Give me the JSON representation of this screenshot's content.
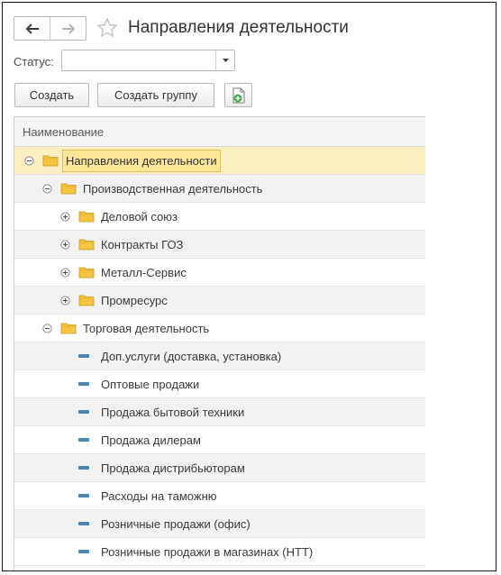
{
  "header": {
    "title": "Направления деятельности",
    "back_icon": "arrow-left-icon",
    "forward_icon": "arrow-right-icon",
    "favorite_icon": "star-icon"
  },
  "filter": {
    "status_label": "Статус:",
    "status_value": ""
  },
  "toolbar": {
    "create_label": "Создать",
    "create_group_label": "Создать группу"
  },
  "table": {
    "column_header": "Наименование",
    "rows": [
      {
        "label": "Направления деятельности",
        "level": 0,
        "kind": "group",
        "state": "expanded"
      },
      {
        "label": "Производственная деятельность",
        "level": 1,
        "kind": "group",
        "state": "expanded"
      },
      {
        "label": "Деловой союз",
        "level": 2,
        "kind": "group",
        "state": "collapsed"
      },
      {
        "label": "Контракты ГОЗ",
        "level": 2,
        "kind": "group",
        "state": "collapsed"
      },
      {
        "label": "Металл-Сервис",
        "level": 2,
        "kind": "group",
        "state": "collapsed"
      },
      {
        "label": "Промресурс",
        "level": 2,
        "kind": "group",
        "state": "collapsed"
      },
      {
        "label": "Торговая деятельность",
        "level": 1,
        "kind": "group",
        "state": "expanded"
      },
      {
        "label": "Доп.услуги (доставка, установка)",
        "level": 2,
        "kind": "item"
      },
      {
        "label": "Оптовые продажи",
        "level": 2,
        "kind": "item"
      },
      {
        "label": "Продажа бытовой техники",
        "level": 2,
        "kind": "item"
      },
      {
        "label": "Продажа дилерам",
        "level": 2,
        "kind": "item"
      },
      {
        "label": "Продажа дистрибьюторам",
        "level": 2,
        "kind": "item"
      },
      {
        "label": "Расходы на таможню",
        "level": 2,
        "kind": "item"
      },
      {
        "label": "Розничные продажи (офис)",
        "level": 2,
        "kind": "item"
      },
      {
        "label": "Розничные продажи в магазинах (НТТ)",
        "level": 2,
        "kind": "item"
      }
    ]
  },
  "colors": {
    "selected_row": "#fcf0c3",
    "folder": "#f5c542",
    "item_marker": "#4a86b3"
  }
}
